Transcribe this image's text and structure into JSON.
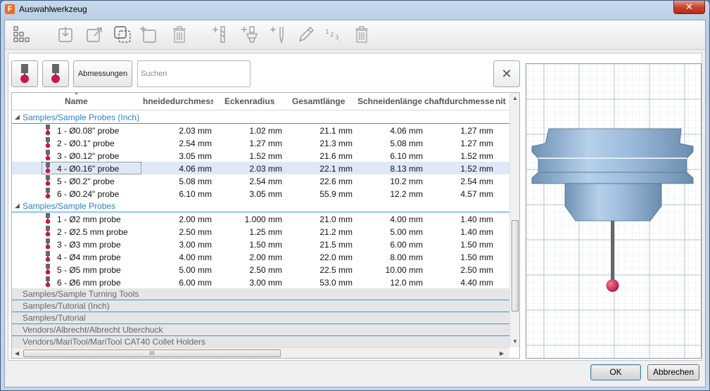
{
  "window": {
    "title": "Auswahlwerkzeug",
    "close_glyph": "✕"
  },
  "toolbar": {
    "icons": [
      "library-icon",
      "import-icon",
      "export-icon",
      "copy-icon",
      "new-icon",
      "delete-icon",
      "add-tool-icon",
      "add-holder-icon",
      "add-insert-icon",
      "edit-icon",
      "renumber-icon",
      "trash-icon"
    ],
    "renumber_label": "1 2 3"
  },
  "filters": {
    "dimensions_label": "Abmessungen",
    "search_placeholder": "Suchen",
    "clear_glyph": "✕"
  },
  "columns": {
    "name": "Name",
    "diameter": "hneidedurchmess",
    "corner_radius": "Eckenradius",
    "overall_length": "Gesamtlänge",
    "flute_length": "Schneidenlänge",
    "shaft_diameter": "chaftdurchmesse",
    "extra": "nit"
  },
  "groups": [
    {
      "name": "Samples/Sample Probes (Inch)",
      "expanded": true,
      "tools": [
        {
          "name": "1 - Ø0.08\" probe",
          "d": "2.03 mm",
          "r": "1.02 mm",
          "l": "21.1 mm",
          "s": "4.06 mm",
          "sh": "1.27 mm"
        },
        {
          "name": "2 - Ø0.1\" probe",
          "d": "2.54 mm",
          "r": "1.27 mm",
          "l": "21.3 mm",
          "s": "5.08 mm",
          "sh": "1.27 mm"
        },
        {
          "name": "3 - Ø0.12\" probe",
          "d": "3.05 mm",
          "r": "1.52 mm",
          "l": "21.6 mm",
          "s": "6.10 mm",
          "sh": "1.52 mm"
        },
        {
          "name": "4 - Ø0.16\" probe",
          "d": "4.06 mm",
          "r": "2.03 mm",
          "l": "22.1 mm",
          "s": "8.13 mm",
          "sh": "1.52 mm",
          "selected": true
        },
        {
          "name": "5 - Ø0.2\" probe",
          "d": "5.08 mm",
          "r": "2.54 mm",
          "l": "22.6 mm",
          "s": "10.2 mm",
          "sh": "2.54 mm"
        },
        {
          "name": "6 - Ø0.24\" probe",
          "d": "6.10 mm",
          "r": "3.05 mm",
          "l": "55.9 mm",
          "s": "12.2 mm",
          "sh": "4.57 mm"
        }
      ]
    },
    {
      "name": "Samples/Sample Probes",
      "expanded": true,
      "tools": [
        {
          "name": "1 - Ø2 mm probe",
          "d": "2.00 mm",
          "r": "1.000 mm",
          "l": "21.0 mm",
          "s": "4.00 mm",
          "sh": "1.40 mm"
        },
        {
          "name": "2 - Ø2.5 mm probe",
          "d": "2.50 mm",
          "r": "1.25 mm",
          "l": "21.2 mm",
          "s": "5.00 mm",
          "sh": "1.40 mm"
        },
        {
          "name": "3 - Ø3 mm probe",
          "d": "3.00 mm",
          "r": "1.50 mm",
          "l": "21.5 mm",
          "s": "6.00 mm",
          "sh": "1.50 mm"
        },
        {
          "name": "4 - Ø4 mm probe",
          "d": "4.00 mm",
          "r": "2.00 mm",
          "l": "22.0 mm",
          "s": "8.00 mm",
          "sh": "1.50 mm"
        },
        {
          "name": "5 - Ø5 mm probe",
          "d": "5.00 mm",
          "r": "2.50 mm",
          "l": "22.5 mm",
          "s": "10.00 mm",
          "sh": "2.50 mm"
        },
        {
          "name": "6 - Ø6 mm probe",
          "d": "6.00 mm",
          "r": "3.00 mm",
          "l": "53.0 mm",
          "s": "12.0 mm",
          "sh": "4.40 mm"
        }
      ]
    },
    {
      "name": "Samples/Sample Turning Tools",
      "expanded": false,
      "tools": []
    },
    {
      "name": "Samples/Tutorial (Inch)",
      "expanded": false,
      "tools": []
    },
    {
      "name": "Samples/Tutorial",
      "expanded": false,
      "tools": []
    },
    {
      "name": "Vendors/Albrecht/Albrecht Uberchuck",
      "expanded": false,
      "tools": []
    },
    {
      "name": "Vendors/MariTool/MariTool CAT40 Collet Holders",
      "expanded": false,
      "tools": []
    }
  ],
  "scroll": {
    "hthumb_glyph": "III"
  },
  "buttons": {
    "ok": "OK",
    "cancel": "Abbrechen"
  },
  "colors": {
    "group_text": "#2f83c8",
    "probe_ball": "#c8184a",
    "holder": "#8fb4d6"
  }
}
